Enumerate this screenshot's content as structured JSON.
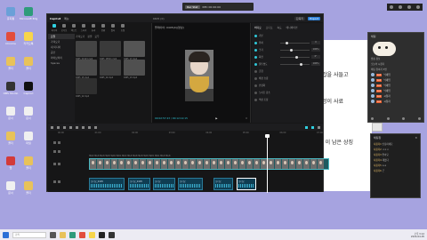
{
  "desktop": {
    "icons": [
      {
        "label": "휴지통",
        "color": "#6aa0d8"
      },
      {
        "label": "Microsoft Edge",
        "color": "#2e9b7a"
      },
      {
        "label": "Chrome",
        "color": "#e24c3c"
      },
      {
        "label": "카카오톡",
        "color": "#f7d54a"
      },
      {
        "label": "폴더",
        "color": "#e8c25a"
      },
      {
        "label": "폴더",
        "color": "#e8c25a"
      },
      {
        "label": "OBS Studio",
        "color": "#333333"
      },
      {
        "label": "CapCut",
        "color": "#111111"
      },
      {
        "label": "문서",
        "color": "#f0f0f0"
      },
      {
        "label": "문서",
        "color": "#f0f0f0"
      },
      {
        "label": "폴더",
        "color": "#e8c25a"
      },
      {
        "label": "파일",
        "color": "#f0f0f0"
      },
      {
        "label": "앱",
        "color": "#d33a3a"
      },
      {
        "label": "폴더",
        "color": "#e8c25a"
      },
      {
        "label": "문서",
        "color": "#f0f0f0"
      },
      {
        "label": "폴더",
        "color": "#e8c25a"
      }
    ]
  },
  "doc_lines": [
    "밥을 사들고",
    "엉이 사료",
    "l 이 남은 상징"
  ],
  "topbar": {
    "rec": "Rec Stat",
    "label": "REC 00:00:00"
  },
  "editor": {
    "app_name": "CapCut",
    "menu": "메뉴",
    "project": "0405 (0)",
    "buttons": [
      "단축키",
      "Export"
    ],
    "tools": [
      "미디어",
      "오디오",
      "텍스트",
      "스티커",
      "효과",
      "전환",
      "필터",
      "조정"
    ],
    "side_items": [
      "로컬",
      "가져오기",
      "내 미디어",
      "공간",
      "라이브러리",
      "Spaces"
    ],
    "media_top": [
      "가져오기",
      "정렬",
      "모두"
    ],
    "thumbs": [
      "0405_20123.mp4",
      "0405_18511.mp4",
      "0405_17.mp4",
      "0405_15.mp4",
      "0405_14.mp4",
      "0405_13.mp4",
      "0405_12.mp4"
    ],
    "player_title": "플레이어: 0405(0)(영상)",
    "timecode": "00:02:57:23 / 00:12:12:15",
    "props_tabs": [
      "비디오",
      "오디오",
      "속도",
      "애니메이션"
    ],
    "props_rows": [
      {
        "label": "기본",
        "value": ""
      },
      {
        "label": "위치",
        "value": "0"
      },
      {
        "label": "크기",
        "value": "100%"
      },
      {
        "label": "회전",
        "value": "0°"
      },
      {
        "label": "불투명도",
        "value": "100%"
      },
      {
        "label": "혼합",
        "value": ""
      },
      {
        "label": "배경 흐림",
        "value": ""
      },
      {
        "label": "안정화",
        "value": ""
      },
      {
        "label": "노이즈 감소",
        "value": ""
      },
      {
        "label": "색상 조정",
        "value": ""
      }
    ],
    "ruler": [
      "00:00",
      "01:00",
      "02:00",
      "03:00",
      "04:00",
      "05:00",
      "06:00",
      "07:00"
    ],
    "text_strip": "텍스트 텍스트 텍스트 텍스트 텍스트 텍스트 텍스트 텍스트 텍스트 텍스트 텍스트 텍스트 텍스트 텍스트 텍스트",
    "sub_clips": [
      "오디오_0405",
      "오디오_0405",
      "오디오",
      "오디오",
      "오디오",
      "오디오"
    ]
  },
  "chat_panel": {
    "header": "채팅",
    "info": [
      "방송 정보",
      "오늘의 시청자",
      "채팅 참여자 3명"
    ],
    "rows": [
      {
        "lv": "Lv.1",
        "name": "닉네임"
      },
      {
        "lv": "Lv.1",
        "name": "닉네임"
      },
      {
        "lv": "Lv.1",
        "name": "닉네임"
      },
      {
        "lv": "Lv.1",
        "name": "닉네임"
      },
      {
        "lv": "Lv.1",
        "name": "시청자"
      },
      {
        "lv": "Lv.1",
        "name": "시청자"
      }
    ]
  },
  "chat2": {
    "header": "채팅창",
    "messages": [
      {
        "name": "사용자1",
        "text": "안녕하세요"
      },
      {
        "name": "사용자2",
        "text": "ㅋㅋㅋ"
      },
      {
        "name": "사용자3",
        "text": "좋아요"
      },
      {
        "name": "사용자4",
        "text": "재밌다"
      },
      {
        "name": "사용자5",
        "text": "ㅎㅎ"
      },
      {
        "name": "사용자6",
        "text": "굿"
      }
    ]
  },
  "taskbar": {
    "search": "검색",
    "time": "오후 3:12",
    "date": "2024-04-05"
  }
}
